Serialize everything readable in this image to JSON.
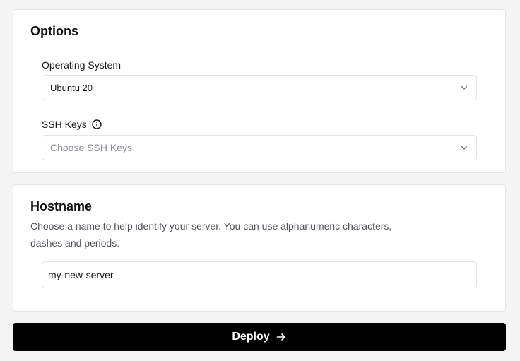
{
  "options": {
    "title": "Options",
    "os": {
      "label": "Operating System",
      "value": "Ubuntu 20"
    },
    "ssh_keys": {
      "label": "SSH Keys",
      "placeholder": "Choose SSH Keys"
    }
  },
  "hostname": {
    "title": "Hostname",
    "description": "Choose a name to help identify your server. You can use alphanumeric characters, dashes and periods.",
    "value": "my-new-server"
  },
  "deploy": {
    "label": "Deploy"
  },
  "icons": {
    "select_chevron": "chevron-down-icon",
    "ssh_info": "info-icon",
    "deploy_arrow": "arrow-right-icon"
  },
  "colors": {
    "page_bg": "#f4f4f5",
    "card_border": "#e4e4e7",
    "button_bg": "#000000",
    "button_text": "#ffffff"
  }
}
